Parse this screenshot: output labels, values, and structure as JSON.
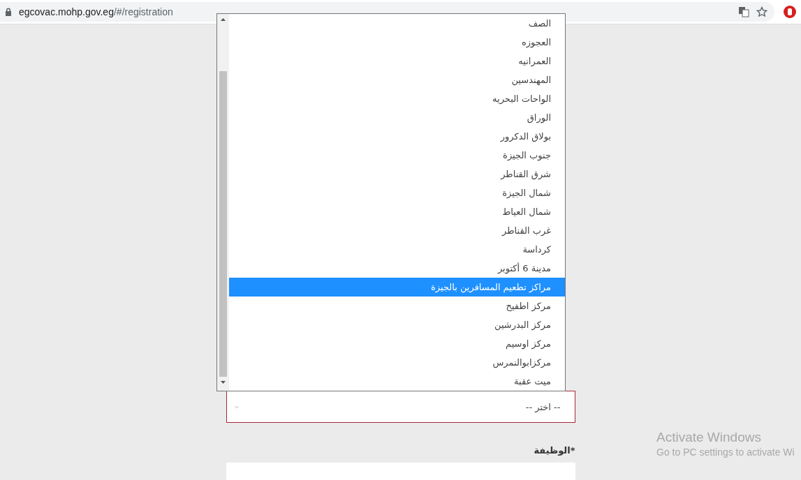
{
  "browser": {
    "url_host": "egcovac.mohp.gov.eg",
    "url_path": "/#/registration"
  },
  "dropdown_list": {
    "items": [
      {
        "label": "الصف",
        "selected": false
      },
      {
        "label": "العجوزه",
        "selected": false
      },
      {
        "label": "العمرانيه",
        "selected": false
      },
      {
        "label": "المهندسين",
        "selected": false
      },
      {
        "label": "الواحات البحريه",
        "selected": false
      },
      {
        "label": "الوراق",
        "selected": false
      },
      {
        "label": "بولاق الدكرور",
        "selected": false
      },
      {
        "label": "جنوب الجيزة",
        "selected": false
      },
      {
        "label": "شرق القناطر",
        "selected": false
      },
      {
        "label": "شمال الجيزة",
        "selected": false
      },
      {
        "label": "شمال العياط",
        "selected": false
      },
      {
        "label": "غرب القناطر",
        "selected": false
      },
      {
        "label": "كرداسة",
        "selected": false
      },
      {
        "label": "مدينة 6 أكتوبر",
        "selected": false
      },
      {
        "label": "مراكز تطعيم المسافرين بالجيزة",
        "selected": true
      },
      {
        "label": "مركز اطفيح",
        "selected": false
      },
      {
        "label": "مركز البدرشين",
        "selected": false
      },
      {
        "label": "مركز اوسيم",
        "selected": false
      },
      {
        "label": "مركزابوالنمرس",
        "selected": false
      },
      {
        "label": "ميت عقبة",
        "selected": false
      }
    ]
  },
  "select": {
    "value": "-- اختر --"
  },
  "job_field": {
    "label": "الوظيفة*"
  },
  "os_notice": {
    "title": "Activate Windows",
    "text": "Go to PC settings to activate Wi"
  }
}
